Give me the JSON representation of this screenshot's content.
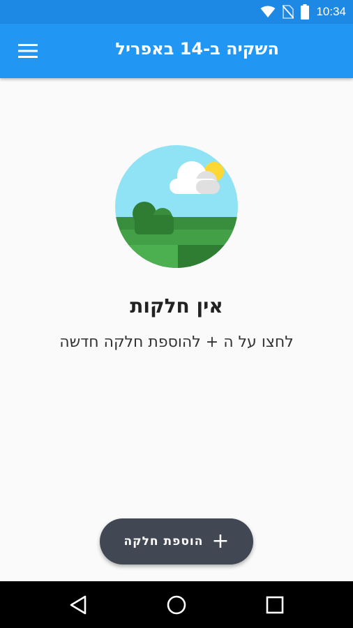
{
  "status_bar": {
    "time": "10:34",
    "icons": [
      "wifi-icon",
      "no-sim-icon",
      "battery-icon"
    ]
  },
  "app_bar": {
    "title": "השקיה ב-14 באפריל",
    "menu_icon": "menu-icon"
  },
  "empty_state": {
    "title": "אין חלקות",
    "subtitle": "לחצו על ה + להוספת חלקה חדשה",
    "illustration": "landscape-illustration"
  },
  "fab": {
    "label": "הוספת חלקה",
    "icon_glyph": "+"
  },
  "nav_bar": {
    "icons": [
      "back-icon",
      "home-icon",
      "recents-icon"
    ]
  },
  "colors": {
    "primary": "#2196f3",
    "primary_dark": "#1e88e5",
    "fab": "#424754",
    "background": "#fafafa"
  }
}
